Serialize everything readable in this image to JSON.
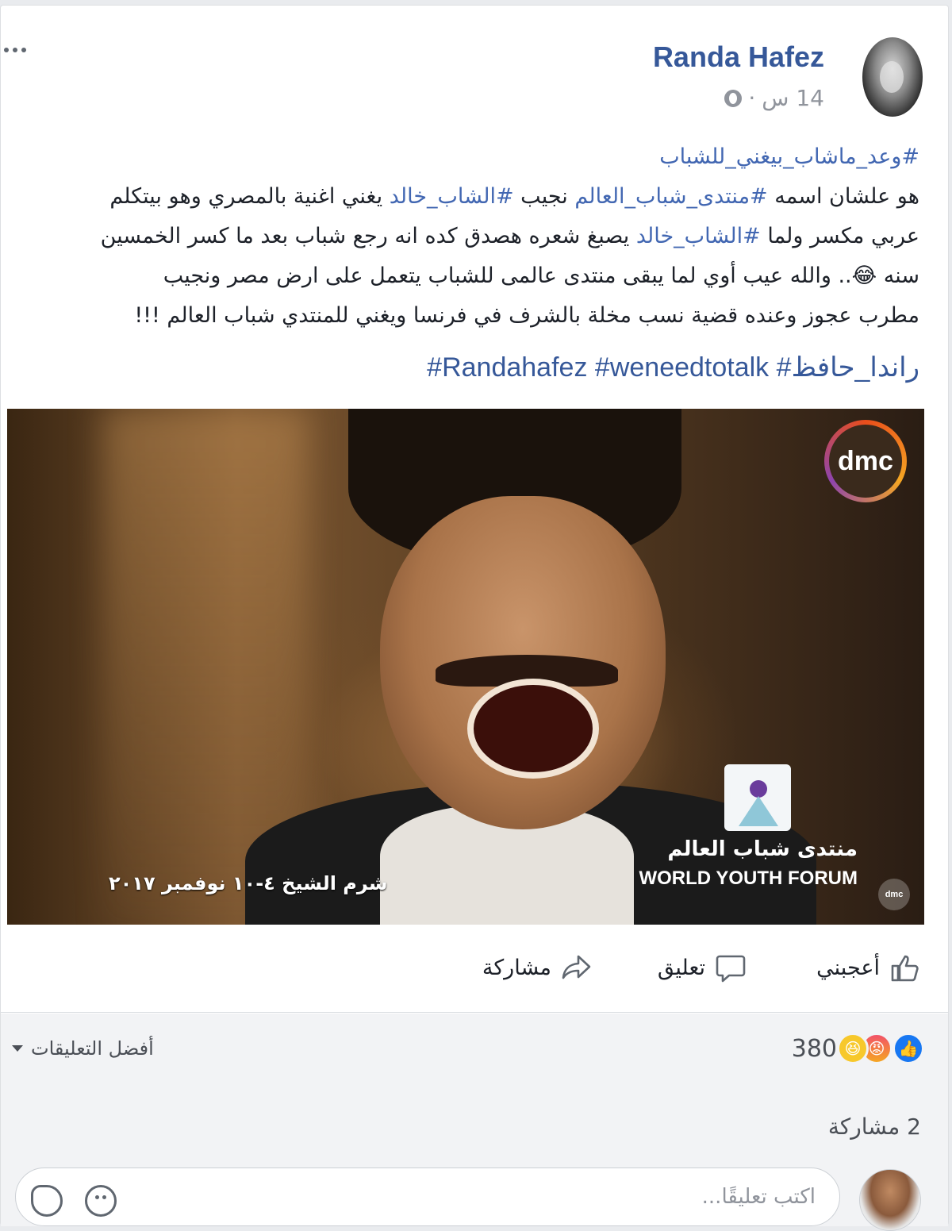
{
  "post": {
    "author": "Randa Hafez",
    "time": "14 س",
    "separator": "·",
    "text_lines": [
      [
        {
          "t": "#وعد_ماشاب_بيغني_للشباب",
          "tag": true
        }
      ],
      [
        {
          "t": "هو علشان اسمه ",
          "tag": false
        },
        {
          "t": "#منتدى_شباب_العالم",
          "tag": true
        },
        {
          "t": " نجيب ",
          "tag": false
        },
        {
          "t": "#الشاب_خالد",
          "tag": true
        },
        {
          "t": " يغني اغنية بالمصري وهو بيتكلم",
          "tag": false
        }
      ],
      [
        {
          "t": "عربي مكسر ولما ",
          "tag": false
        },
        {
          "t": "#الشاب_خالد",
          "tag": true
        },
        {
          "t": " يصبغ شعره هصدق كده انه رجع شباب بعد ما كسر الخمسين",
          "tag": false
        }
      ],
      [
        {
          "t": "سنه 😂.. والله عيب أوي لما يبقى منتدى عالمى للشباب يتعمل على ارض مصر ونجيب",
          "tag": false
        }
      ],
      [
        {
          "t": "مطرب عجوز وعنده قضية نسب مخلة بالشرف في فرنسا ويغني للمنتدي شباب العالم !!!",
          "tag": false
        }
      ]
    ],
    "tags_line": [
      "#Randahafez",
      "#weneedtotalk",
      "#راندا_حافظ"
    ]
  },
  "video": {
    "channel_logo": "dmc",
    "channel_logo_small": "dmc",
    "forum_name_ar": "منتدى شباب العالم",
    "forum_name_en": "WORLD YOUTH FORUM",
    "event_line": "شرم الشيخ ٤-١٠ نوفمبر ٢٠١٧"
  },
  "actions": {
    "like": "أعجبني",
    "comment": "تعليق",
    "share": "مشاركة"
  },
  "stats": {
    "reactions_count": "380",
    "reaction_icons": [
      "like-icon",
      "angry-icon",
      "haha-icon"
    ],
    "sort_label": "أفضل التعليقات",
    "shares": "2 مشاركة"
  },
  "composer": {
    "placeholder": "اكتب تعليقًا..."
  },
  "colors": {
    "link": "#365899",
    "hashtag": "#4267b2",
    "like_blue": "#1877f2"
  }
}
